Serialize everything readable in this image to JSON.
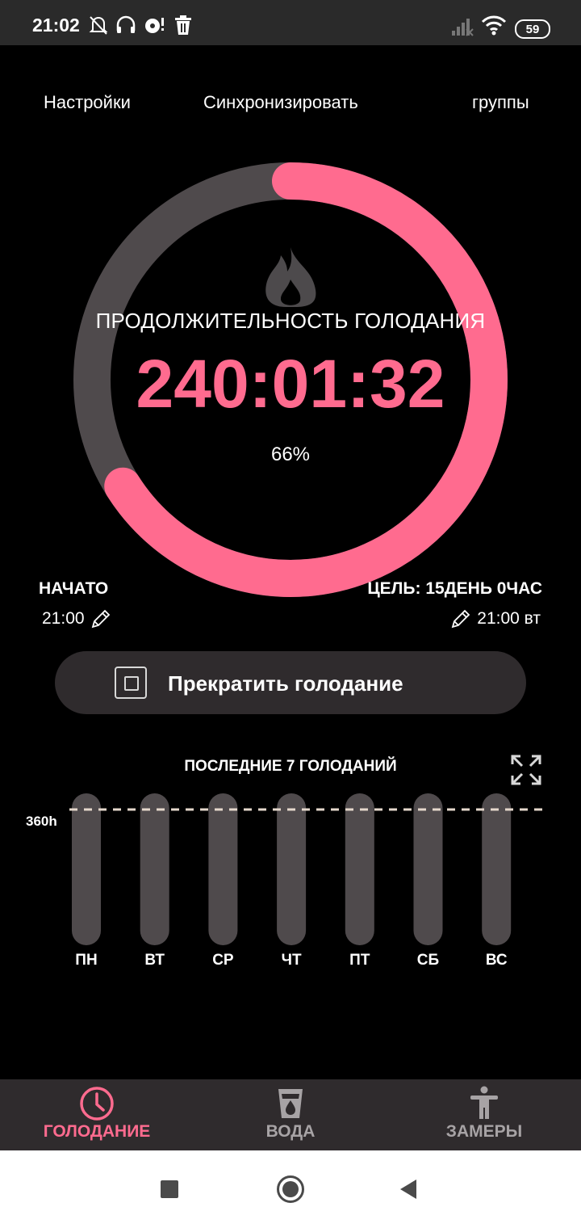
{
  "status_bar": {
    "time": "21:02",
    "battery": "59",
    "icons": [
      "bell-off-icon",
      "headphones-icon",
      "notification-icon",
      "trash-icon",
      "signal-icon",
      "wifi-icon",
      "battery-icon"
    ]
  },
  "top_nav": {
    "settings": "Настройки",
    "sync": "Синхронизировать",
    "groups": "группы"
  },
  "timer": {
    "caption": "ПРОДОЛЖИТЕЛЬНОСТЬ ГОЛОДАНИЯ",
    "elapsed": "240:01:32",
    "percent": "66%",
    "progress_fraction": 0.66,
    "icon": "flame-icon"
  },
  "start": {
    "label": "НАЧАТО",
    "value": "21:00"
  },
  "goal": {
    "label": "ЦЕЛЬ: 15ДЕНЬ 0ЧАС",
    "value": "21:00 вт"
  },
  "stop_button": {
    "label": "Прекратить голодание",
    "icon": "stop-square-icon"
  },
  "chart_data": {
    "type": "bar",
    "title": "ПОСЛЕДНИЕ 7 ГОЛОДАНИЙ",
    "categories": [
      "ПН",
      "ВТ",
      "СР",
      "ЧТ",
      "ПТ",
      "СБ",
      "ВС"
    ],
    "target_label": "360h",
    "target_hours": 360,
    "ylim": [
      0,
      360
    ],
    "series": [
      {
        "values": [
          0,
          0,
          0,
          0,
          0,
          0,
          0
        ]
      }
    ]
  },
  "bottom_nav": {
    "items": [
      {
        "label": "ГОЛОДАНИЕ",
        "icon": "clock-icon",
        "active": true
      },
      {
        "label": "ВОДА",
        "icon": "water-glass-icon",
        "active": false
      },
      {
        "label": "ЗАМЕРЫ",
        "icon": "person-icon",
        "active": false
      }
    ]
  },
  "colors": {
    "accent": "#ff6b8f",
    "track": "#4f4a4c",
    "card": "#2f2b2d",
    "background": "#000000"
  }
}
